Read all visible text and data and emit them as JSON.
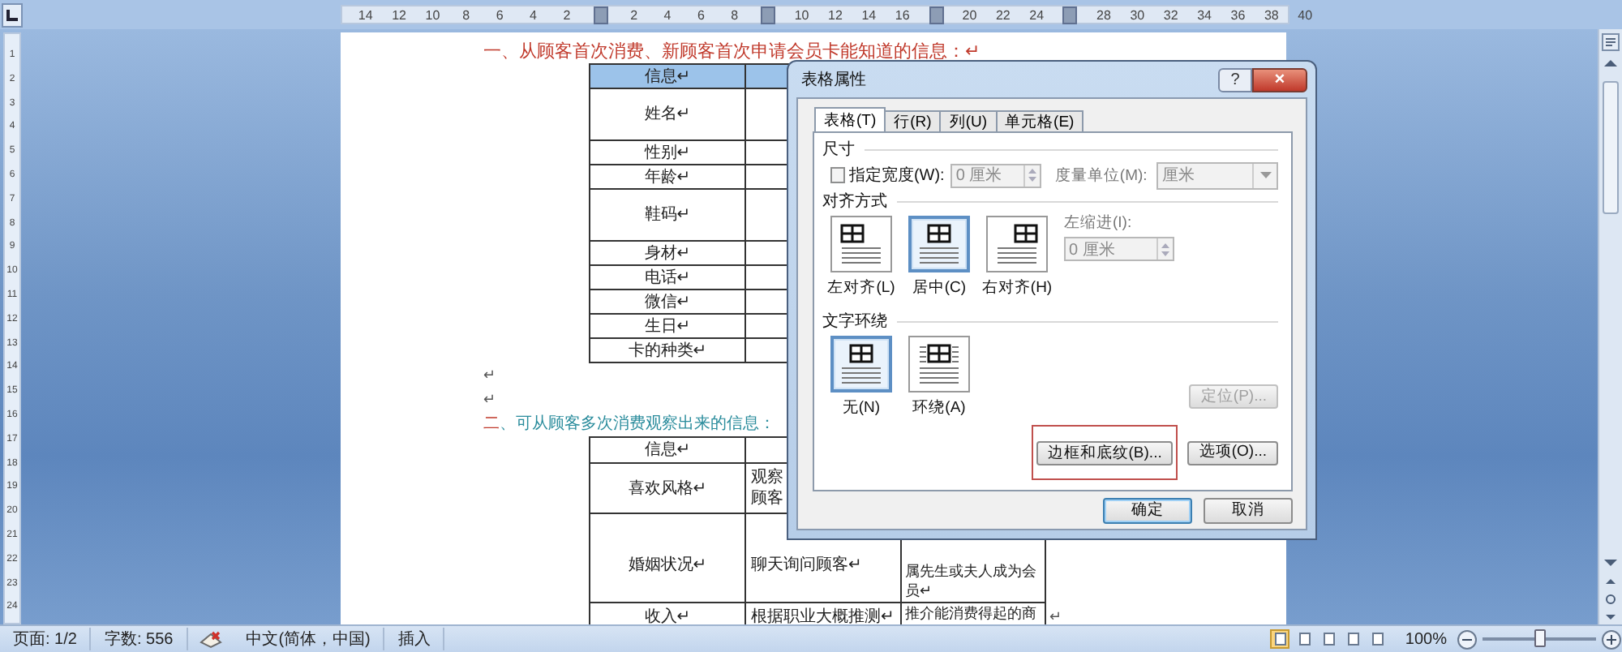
{
  "ruler": {
    "marks": [
      {
        "kind": "number",
        "text": "14"
      },
      {
        "kind": "number",
        "text": "12"
      },
      {
        "kind": "number",
        "text": "10"
      },
      {
        "kind": "number",
        "text": "8"
      },
      {
        "kind": "number",
        "text": "6"
      },
      {
        "kind": "number",
        "text": "4"
      },
      {
        "kind": "number",
        "text": "2"
      },
      {
        "kind": "marker"
      },
      {
        "kind": "number",
        "text": "2"
      },
      {
        "kind": "number",
        "text": "4"
      },
      {
        "kind": "number",
        "text": "6"
      },
      {
        "kind": "number",
        "text": "8"
      },
      {
        "kind": "marker"
      },
      {
        "kind": "number",
        "text": "10"
      },
      {
        "kind": "number",
        "text": "12"
      },
      {
        "kind": "number",
        "text": "14"
      },
      {
        "kind": "number",
        "text": "16"
      },
      {
        "kind": "marker"
      },
      {
        "kind": "number",
        "text": "20"
      },
      {
        "kind": "number",
        "text": "22"
      },
      {
        "kind": "number",
        "text": "24"
      },
      {
        "kind": "marker"
      },
      {
        "kind": "number",
        "text": "28"
      },
      {
        "kind": "number",
        "text": "30"
      },
      {
        "kind": "number",
        "text": "32"
      },
      {
        "kind": "number",
        "text": "34"
      },
      {
        "kind": "number",
        "text": "36"
      },
      {
        "kind": "number",
        "text": "38"
      },
      {
        "kind": "number",
        "text": "40"
      }
    ]
  },
  "vertical_ruler": {
    "numbers": [
      "1",
      "2",
      "3",
      "4",
      "5",
      "6",
      "7",
      "8",
      "9",
      "10",
      "11",
      "12",
      "13",
      "14",
      "15",
      "16",
      "17",
      "18",
      "19",
      "20",
      "21",
      "22",
      "23",
      "24"
    ]
  },
  "document": {
    "heading_1": "一、从顾客首次消费、新顾客首次申请会员卡能知道的信息：↵",
    "table_1": {
      "rows": [
        {
          "label": "信息↵",
          "selected": true
        },
        {
          "label": "姓名↵",
          "selected": false
        },
        {
          "label": "性别↵",
          "selected": false
        },
        {
          "label": "年龄↵",
          "selected": false
        },
        {
          "label": "鞋码↵",
          "selected": false
        },
        {
          "label": "身材↵",
          "selected": false
        },
        {
          "label": "电话↵",
          "selected": false
        },
        {
          "label": "微信↵",
          "selected": false
        },
        {
          "label": "生日↵",
          "selected": false
        },
        {
          "label": "卡的种类↵",
          "selected": false
        }
      ]
    },
    "empty_paragraphs": [
      "↵",
      "↵"
    ],
    "heading_2": {
      "parts": [
        {
          "text": "二",
          "color": "#c0392b"
        },
        {
          "text": "、可从顾客多次消费观察出来的信息：",
          "color": "#2a8c9c"
        }
      ]
    },
    "table_2": {
      "rows": [
        {
          "cells": [
            [
              "信息↵"
            ],
            [],
            []
          ]
        },
        {
          "cells": [
            [
              "喜欢风格↵"
            ],
            [
              "观察",
              "顾客"
            ],
            []
          ]
        },
        {
          "cells": [
            [
              "婚姻状况↵"
            ],
            [
              "聊天询问顾客↵"
            ],
            [
              "属先生或夫人成为会",
              "员↵"
            ]
          ]
        },
        {
          "cells": [
            [
              "收入↵"
            ],
            [
              "根据职业大概推测↵"
            ],
            [
              "推介能消费得起的商"
            ]
          ]
        }
      ],
      "row_end_mark": "↵"
    }
  },
  "dialog": {
    "title": "表格属性",
    "help": "?",
    "close": "×",
    "tabs": [
      {
        "label": "表格(T)",
        "selected": true
      },
      {
        "label": "行(R)",
        "selected": false
      },
      {
        "label": "列(U)",
        "selected": false
      },
      {
        "label": "单元格(E)",
        "selected": false
      }
    ],
    "size": {
      "heading": "尺寸",
      "checkbox_label": "指定宽度(W):",
      "checked": false,
      "width": "0 厘米",
      "unit_label": "度量单位(M):",
      "unit": "厘米"
    },
    "alignment": {
      "heading": "对齐方式",
      "options": [
        {
          "label": "左对齐(L)",
          "kind": "left",
          "selected": false
        },
        {
          "label": "居中(C)",
          "kind": "center",
          "selected": true
        },
        {
          "label": "右对齐(H)",
          "kind": "right",
          "selected": false
        }
      ],
      "indent_label": "左缩进(I):",
      "indent": "0 厘米"
    },
    "wrapping": {
      "heading": "文字环绕",
      "options": [
        {
          "label": "无(N)",
          "kind": "none",
          "selected": true
        },
        {
          "label": "环绕(A)",
          "kind": "around",
          "selected": false
        }
      ],
      "position_button": "定位(P)..."
    },
    "borders_button": "边框和底纹(B)...",
    "options_button": "选项(O)...",
    "ok": "确定",
    "cancel": "取消"
  },
  "status_bar": {
    "page": "页面: 1/2",
    "words": "字数: 556",
    "language": "中文(简体，中国)",
    "mode": "插入",
    "views": [
      {
        "selected": true
      },
      {
        "selected": false
      },
      {
        "selected": false
      },
      {
        "selected": false
      },
      {
        "selected": false
      }
    ],
    "zoom": "100%",
    "zoom_level": {
      "level": 0.5
    }
  }
}
